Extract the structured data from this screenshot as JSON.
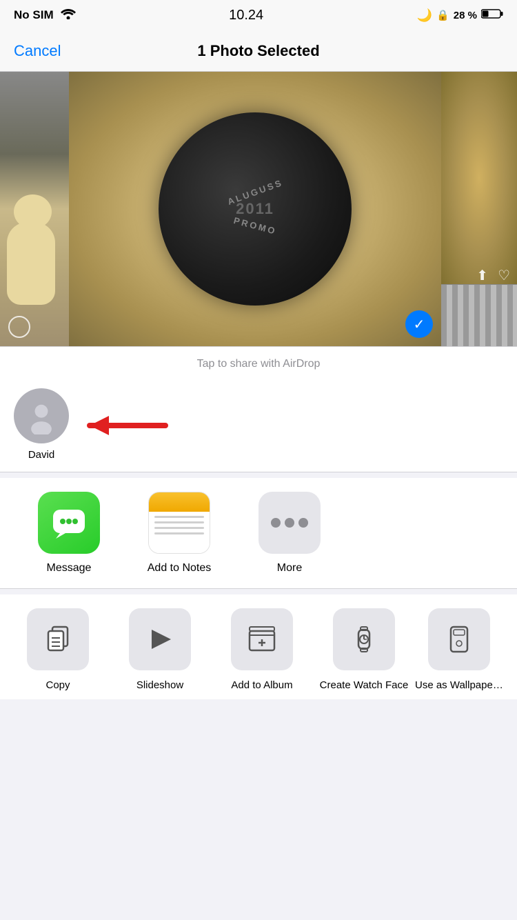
{
  "statusBar": {
    "carrier": "No SIM",
    "time": "10.24",
    "battery": "28 %"
  },
  "navBar": {
    "cancel": "Cancel",
    "title": "1 Photo Selected"
  },
  "airdrop": {
    "hint": "Tap to share with AirDrop",
    "contacts": [
      {
        "name": "David"
      }
    ]
  },
  "apps": [
    {
      "id": "message",
      "label": "Message"
    },
    {
      "id": "notes",
      "label": "Add to Notes"
    },
    {
      "id": "more",
      "label": "More"
    }
  ],
  "actions": [
    {
      "id": "copy",
      "label": "Copy"
    },
    {
      "id": "slideshow",
      "label": "Slideshow"
    },
    {
      "id": "add-album",
      "label": "Add to Album"
    },
    {
      "id": "watch-face",
      "label": "Create Watch Face"
    },
    {
      "id": "wallpaper",
      "label": "Use as Wallpape…"
    }
  ]
}
